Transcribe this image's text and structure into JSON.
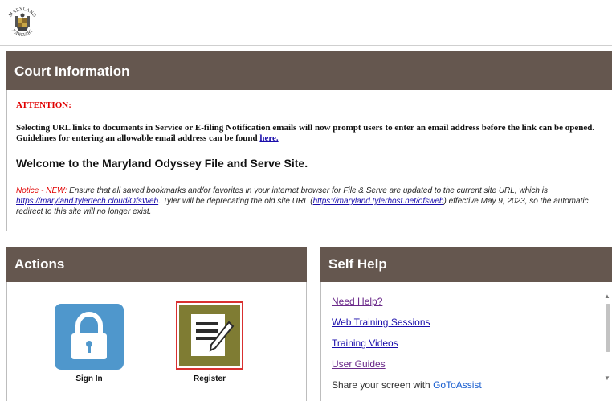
{
  "header": {
    "seal_text_top": "MARYLAND",
    "seal_text_bottom": "JUDICIARY"
  },
  "court_info": {
    "title": "Court Information",
    "attention": "ATTENTION:",
    "selecting_text": "Selecting URL links to documents in Service or E-filing Notification emails will now prompt users to enter an email address before the link can be opened. Guidelines for entering an allowable email address can be found ",
    "here_link": "here.",
    "welcome": "Welcome to the Maryland Odyssey File and Serve Site.",
    "notice_label": "Notice - NEW:",
    "notice_part1": " Ensure that all saved bookmarks and/or favorites in your internet browser for File & Serve are updated to the current site URL, which is ",
    "notice_link1": "https://maryland.tylertech.cloud/OfsWeb",
    "notice_part2": ". Tyler will be deprecating the old site URL (",
    "notice_link2": "https://maryland.tylerhost.net/ofsweb",
    "notice_part3": ") effective May 9, 2023, so the automatic redirect to this site will no longer exist."
  },
  "actions": {
    "title": "Actions",
    "sign_in_label": "Sign In",
    "register_label": "Register"
  },
  "self_help": {
    "title": "Self Help",
    "links": [
      "Need Help?",
      "Web Training Sessions",
      "Training Videos",
      "User Guides"
    ],
    "share_text": "Share your screen with ",
    "share_link": "GoToAssist"
  },
  "icons": {
    "seal": "maryland-judiciary-seal-icon",
    "sign_in": "lock-icon",
    "register": "document-pencil-icon",
    "scroll_up": "scroll-up-arrow-icon",
    "scroll_down": "scroll-down-arrow-icon"
  },
  "colors": {
    "panel_header": "#65574f",
    "sign_in_tile": "#4f97cc",
    "register_tile": "#7f7c33",
    "register_highlight": "#d93030",
    "attention": "#e00000",
    "link": "#1a0dab",
    "visited_link": "#6b2a8a"
  }
}
